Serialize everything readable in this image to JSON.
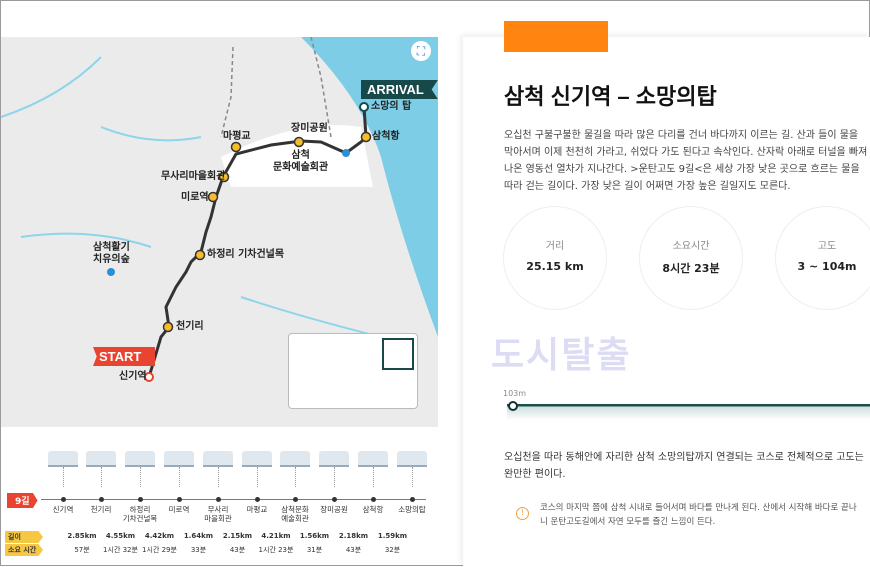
{
  "map": {
    "arrival_label": "ARRIVAL",
    "start_label": "START",
    "places": [
      {
        "name": "소망의 탑"
      },
      {
        "name": "삼척항"
      },
      {
        "name": "장미공원"
      },
      {
        "name": "삼척\n문화예술회관"
      },
      {
        "name": "마평교"
      },
      {
        "name": "무사리마을회관"
      },
      {
        "name": "미로역"
      },
      {
        "name": "하정리 기차건널목"
      },
      {
        "name": "천기리"
      },
      {
        "name": "신기역"
      },
      {
        "name": "삼척활기\n치유의숲"
      }
    ],
    "fullscreen_icon": "fullscreen-icon"
  },
  "course": {
    "tag": "9길",
    "length_label": "길이",
    "time_label": "소요 시간",
    "stops": [
      "신기역",
      "천기리",
      "하정리\n기차건널목",
      "미로역",
      "무사리\n마을회관",
      "마평교",
      "삼척문화\n예술회관",
      "장미공원",
      "삼척항",
      "소망의탑"
    ],
    "segments": [
      {
        "length": "2.85km",
        "time": "57분"
      },
      {
        "length": "4.55km",
        "time": "1시간 32분"
      },
      {
        "length": "4.42km",
        "time": "1시간 29분"
      },
      {
        "length": "1.64km",
        "time": "33분"
      },
      {
        "length": "2.15km",
        "time": "43분"
      },
      {
        "length": "4.21km",
        "time": "1시간 23분"
      },
      {
        "length": "1.56km",
        "time": "31분"
      },
      {
        "length": "2.18km",
        "time": "43분"
      },
      {
        "length": "1.59km",
        "time": "32분"
      }
    ]
  },
  "detail": {
    "title": "삼척 신기역 – 소망의탑",
    "description": "오십천 구불구불한 물길을 따라 많은 다리를 건너 바다까지 이르는 길. 산과 들이 물을 막아서며 이제 천천히 가라고, 쉬었다 가도 된다고 속삭인다. 산자락 아래로 터널을 빠져나온 영동선 열차가 지나간다. >운탄고도 9길<은 세상 가장 낮은 곳으로 흐르는 물을 따라 걷는 길이다. 가장 낮은 길이 어쩌면 가장 높은 길일지도 모른다.",
    "stats": [
      {
        "label": "거리",
        "value": "25.15 km"
      },
      {
        "label": "소요시간",
        "value": "8시간 23분"
      },
      {
        "label": "고도",
        "value": "3 ~ 104m"
      }
    ],
    "watermark": "도시탈출",
    "elevation_start": "103m",
    "elevation_note": "오십천을 따라 동해안에 자리한 삼척 소망의탑까지 연결되는 코스로 전체적으로 고도는 완만한 편이다.",
    "tip": "코스의 마지막 쯤에 삼척 시내로 들어서며 바다를 만나게 된다. 산에서 시작해 바다로 끝나니 운탄고도길에서 자연 모두를 즐긴 느낌이 든다.",
    "accent": "#ff8510"
  }
}
